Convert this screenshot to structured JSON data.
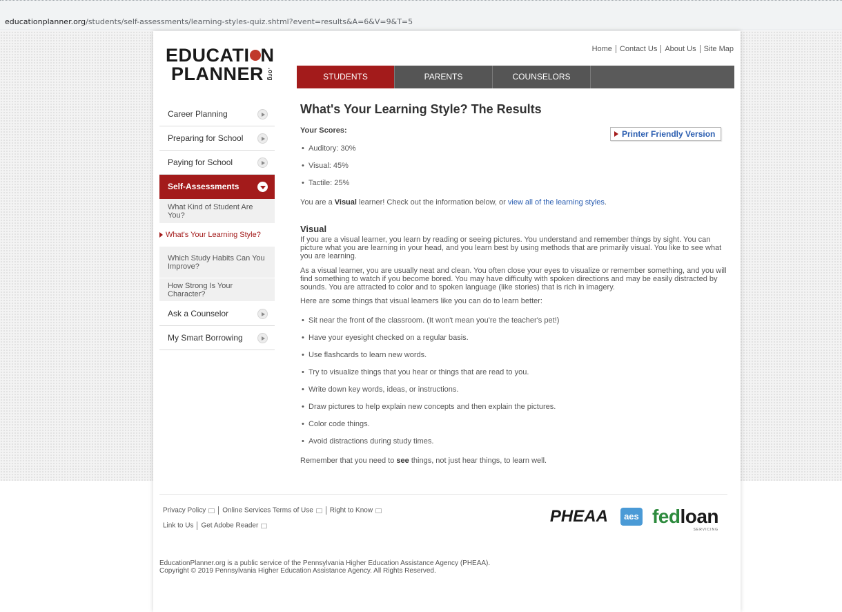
{
  "browser": {
    "url_domain": "educationplanner.org",
    "url_path": "/students/self-assessments/learning-styles-quiz.shtml?event=results&A=6&V=9&T=5"
  },
  "logo": {
    "line1_a": "EDUCATI",
    "line1_b": "N",
    "line2": "PLANNER",
    "org": ".org"
  },
  "top_links": [
    "Home",
    "Contact Us",
    "About Us",
    "Site Map"
  ],
  "tabs": [
    "STUDENTS",
    "PARENTS",
    "COUNSELORS"
  ],
  "sidebar": {
    "items": [
      {
        "label": "Career Planning"
      },
      {
        "label": "Preparing for School"
      },
      {
        "label": "Paying for School"
      },
      {
        "label": "Self-Assessments"
      },
      {
        "label": "Ask a Counselor"
      },
      {
        "label": "My Smart Borrowing"
      }
    ],
    "subitems": [
      {
        "label": "What Kind of Student Are You?"
      },
      {
        "label": "What's Your Learning Style?"
      },
      {
        "label": "Which Study Habits Can You Improve?"
      },
      {
        "label": "How Strong Is Your Character?"
      }
    ]
  },
  "main": {
    "title": "What's Your Learning Style? The Results",
    "scores_label": "Your Scores:",
    "printer_label": "Printer Friendly Version",
    "scores": [
      "Auditory: 30%",
      "Visual: 45%",
      "Tactile: 25%"
    ],
    "result_pre": "You are a ",
    "result_style": "Visual",
    "result_mid": " learner! Check out the information below, or ",
    "result_link": "view all of the learning styles",
    "result_end": ".",
    "section_title": "Visual",
    "para1": "If you are a visual learner, you learn by reading or seeing pictures. You understand and remember things by sight. You can picture what you are learning in your head, and you learn best by using methods that are primarily visual. You like to see what you are learning.",
    "para2": "As a visual learner, you are usually neat and clean. You often close your eyes to visualize or remember something, and you will find something to watch if you become bored. You may have difficulty with spoken directions and may be easily distracted by sounds. You are attracted to color and to spoken language (like stories) that is rich in imagery.",
    "para3": "Here are some things that visual learners like you can do to learn better:",
    "tips": [
      "Sit near the front of the classroom. (It won't mean you're the teacher's pet!)",
      "Have your eyesight checked on a regular basis.",
      "Use flashcards to learn new words.",
      "Try to visualize things that you hear or things that are read to you.",
      "Write down key words, ideas, or instructions.",
      "Draw pictures to help explain new concepts and then explain the pictures.",
      "Color code things.",
      "Avoid distractions during study times."
    ],
    "closing_pre": "Remember that you need to ",
    "closing_bold": "see",
    "closing_end": " things, not just hear things, to learn well."
  },
  "footer": {
    "links_row1": [
      "Privacy Policy",
      "Online Services Terms of Use",
      "Right to Know"
    ],
    "links_row2": [
      "Link to Us",
      "Get Adobe Reader"
    ],
    "logo_pheaa": "PHEAA",
    "logo_aes": "aes",
    "logo_fed_a": "fed",
    "logo_fed_b": "loan",
    "logo_fed_sub": "SERVICING",
    "legal1": "EducationPlanner.org is a public service of the Pennsylvania Higher Education Assistance Agency (PHEAA).",
    "legal2": "Copyright © 2019 Pennsylvania Higher Education Assistance Agency. All Rights Reserved."
  },
  "colors": {
    "brand_red": "#a31b1b",
    "nav_gray": "#5a5a5a",
    "link_blue": "#2a5db0"
  }
}
